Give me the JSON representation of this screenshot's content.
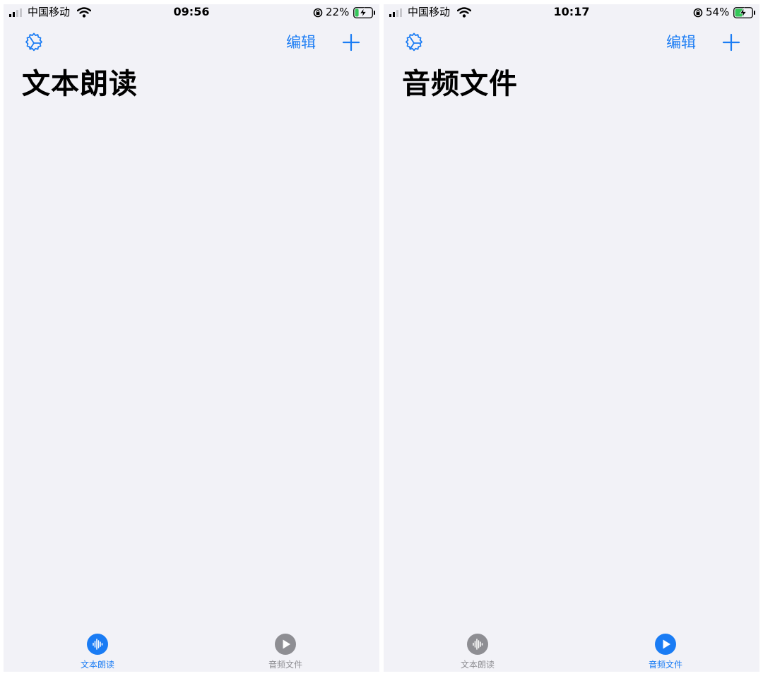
{
  "colors": {
    "accent": "#1a7cf4",
    "inactive": "#8e8e93",
    "background": "#f2f2f7",
    "battery_charging": "#34c759"
  },
  "left": {
    "status": {
      "carrier": "中国移动",
      "time": "09:56",
      "battery": "22%",
      "battery_level": 0.22
    },
    "nav": {
      "settings_icon": "gear-icon",
      "edit_label": "编辑",
      "add_icon": "plus-icon"
    },
    "title": "文本朗读",
    "tabs": [
      {
        "label": "文本朗读",
        "icon": "waveform-icon",
        "active": true
      },
      {
        "label": "音频文件",
        "icon": "play-circle-icon",
        "active": false
      }
    ]
  },
  "right": {
    "status": {
      "carrier": "中国移动",
      "time": "10:17",
      "battery": "54%",
      "battery_level": 0.54
    },
    "nav": {
      "settings_icon": "gear-icon",
      "edit_label": "编辑",
      "add_icon": "plus-icon"
    },
    "title": "音频文件",
    "tabs": [
      {
        "label": "文本朗读",
        "icon": "waveform-icon",
        "active": false
      },
      {
        "label": "音频文件",
        "icon": "play-circle-icon",
        "active": true
      }
    ]
  }
}
